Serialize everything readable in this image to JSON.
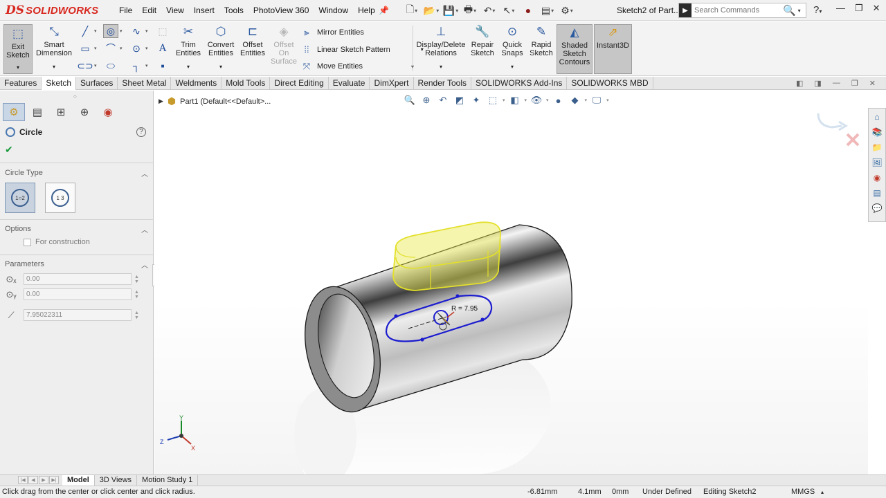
{
  "app": {
    "logo_mark": "DS",
    "brand": "SOLIDWORKS",
    "document_title": "Sketch2 of Part...",
    "menus": [
      "File",
      "Edit",
      "View",
      "Insert",
      "Tools",
      "PhotoView 360",
      "Window",
      "Help"
    ],
    "search_placeholder": "Search Commands",
    "help_label": "?"
  },
  "ribbon": {
    "exit_sketch": "Exit Sketch",
    "smart_dimension": "Smart Dimension",
    "trim_entities": "Trim Entities",
    "convert_entities": "Convert Entities",
    "offset_entities": "Offset Entities",
    "offset_on_surface": "Offset On Surface",
    "mirror_entities": "Mirror Entities",
    "linear_sketch_pattern": "Linear Sketch Pattern",
    "move_entities": "Move Entities",
    "display_delete_relations": "Display/Delete Relations",
    "repair_sketch": "Repair Sketch",
    "quick_snaps": "Quick Snaps",
    "rapid_sketch": "Rapid Sketch",
    "shaded_sketch_contours": "Shaded Sketch Contours",
    "instant3d": "Instant3D"
  },
  "tabs": [
    "Features",
    "Sketch",
    "Surfaces",
    "Sheet Metal",
    "Weldments",
    "Mold Tools",
    "Direct Editing",
    "Evaluate",
    "DimXpert",
    "Render Tools",
    "SOLIDWORKS Add-Ins",
    "SOLIDWORKS MBD"
  ],
  "active_tab": "Sketch",
  "property_manager": {
    "title": "Circle",
    "ok_glyph": "✔",
    "circle_type_header": "Circle Type",
    "circle_type_options": [
      "center-circle",
      "perimeter-circle"
    ],
    "options_header": "Options",
    "for_construction_label": "For construction",
    "for_construction_checked": false,
    "parameters_header": "Parameters",
    "param_x": "0.00",
    "param_y": "0.00",
    "param_radius": "7.95022311"
  },
  "feature_tree": {
    "part_label": "Part1  (Default<<Default>..."
  },
  "viewport": {
    "dimension_label": "R = 7.95",
    "axis_labels": {
      "x": "X",
      "y": "Y",
      "z": "Z"
    }
  },
  "bottom_tabs": [
    "Model",
    "3D Views",
    "Motion Study 1"
  ],
  "active_bottom_tab": "Model",
  "status": {
    "hint": "Click drag from the center or click center and click radius.",
    "x_coord": "-6.81mm",
    "y_coord": "4.1mm",
    "z_coord": "0mm",
    "definition": "Under Defined",
    "editing": "Editing Sketch2",
    "units": "MMGS"
  },
  "colors": {
    "brand_red": "#d8281f",
    "sketch_blue": "#1c1ccf",
    "preview_yellow": "#e8e84a",
    "ok_green": "#1a9a3b"
  }
}
